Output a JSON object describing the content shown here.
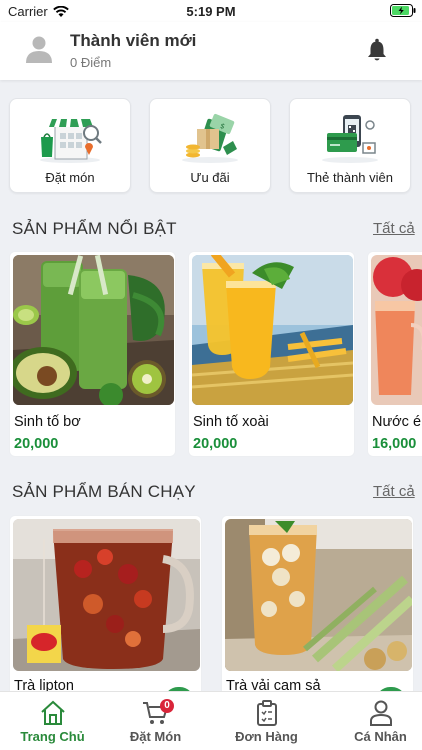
{
  "status_bar": {
    "carrier": "Carrier",
    "time": "5:19 PM"
  },
  "header": {
    "member_name": "Thành viên mới",
    "points": "0 Điểm"
  },
  "quick_actions": [
    {
      "label": "Đặt món"
    },
    {
      "label": "Ưu đãi"
    },
    {
      "label": "Thẻ thành viên"
    }
  ],
  "featured": {
    "title": "SẢN PHẨM NỔI BẬT",
    "see_all": "Tất cả",
    "items": [
      {
        "name": "Sinh tố bơ",
        "price": "20,000"
      },
      {
        "name": "Sinh tố xoài",
        "price": "20,000"
      },
      {
        "name": "Nước é",
        "price": "16,000"
      }
    ]
  },
  "best_selling": {
    "title": "SẢN PHẨM BÁN CHẠY",
    "see_all": "Tất cả",
    "items": [
      {
        "name": "Trà lipton"
      },
      {
        "name": "Trà vải cam sả"
      }
    ]
  },
  "tabs": [
    {
      "label": "Trang Chủ",
      "active": true
    },
    {
      "label": "Đặt Món",
      "badge": "0"
    },
    {
      "label": "Đơn Hàng"
    },
    {
      "label": "Cá Nhân"
    }
  ],
  "colors": {
    "accent": "#2a8a3b",
    "price": "#1a8f3a",
    "badge": "#d9253a",
    "background": "#eef0f4"
  }
}
